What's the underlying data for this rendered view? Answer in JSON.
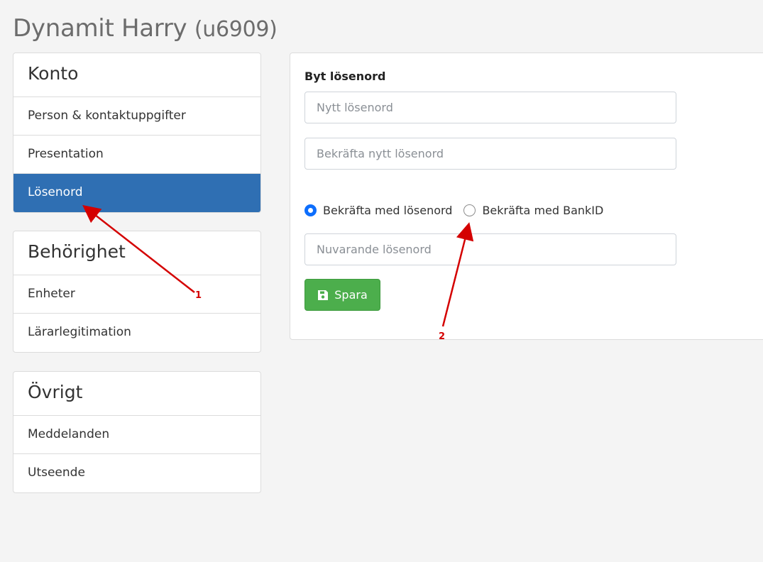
{
  "header": {
    "name": "Dynamit Harry",
    "user_id": "(u6909)"
  },
  "sidebar": {
    "sections": [
      {
        "heading": "Konto",
        "items": [
          "Person & kontaktuppgifter",
          "Presentation",
          "Lösenord"
        ]
      },
      {
        "heading": "Behörighet",
        "items": [
          "Enheter",
          "Lärarlegitimation"
        ]
      },
      {
        "heading": "Övrigt",
        "items": [
          "Meddelanden",
          "Utseende"
        ]
      }
    ],
    "active_item": "Lösenord"
  },
  "form": {
    "title": "Byt lösenord",
    "new_password_placeholder": "Nytt lösenord",
    "confirm_password_placeholder": "Bekräfta nytt lösenord",
    "radio_password_label": "Bekräfta med lösenord",
    "radio_bankid_label": "Bekräfta med BankID",
    "selected_radio": "password",
    "current_password_placeholder": "Nuvarande lösenord",
    "save_label": "Spara"
  },
  "annotations": {
    "label_1": "1",
    "label_2": "2"
  },
  "colors": {
    "active_bg": "#2f6fb3",
    "save_button": "#4cae4c",
    "radio_checked": "#0d6efd",
    "annotation_arrow": "#d40000"
  }
}
